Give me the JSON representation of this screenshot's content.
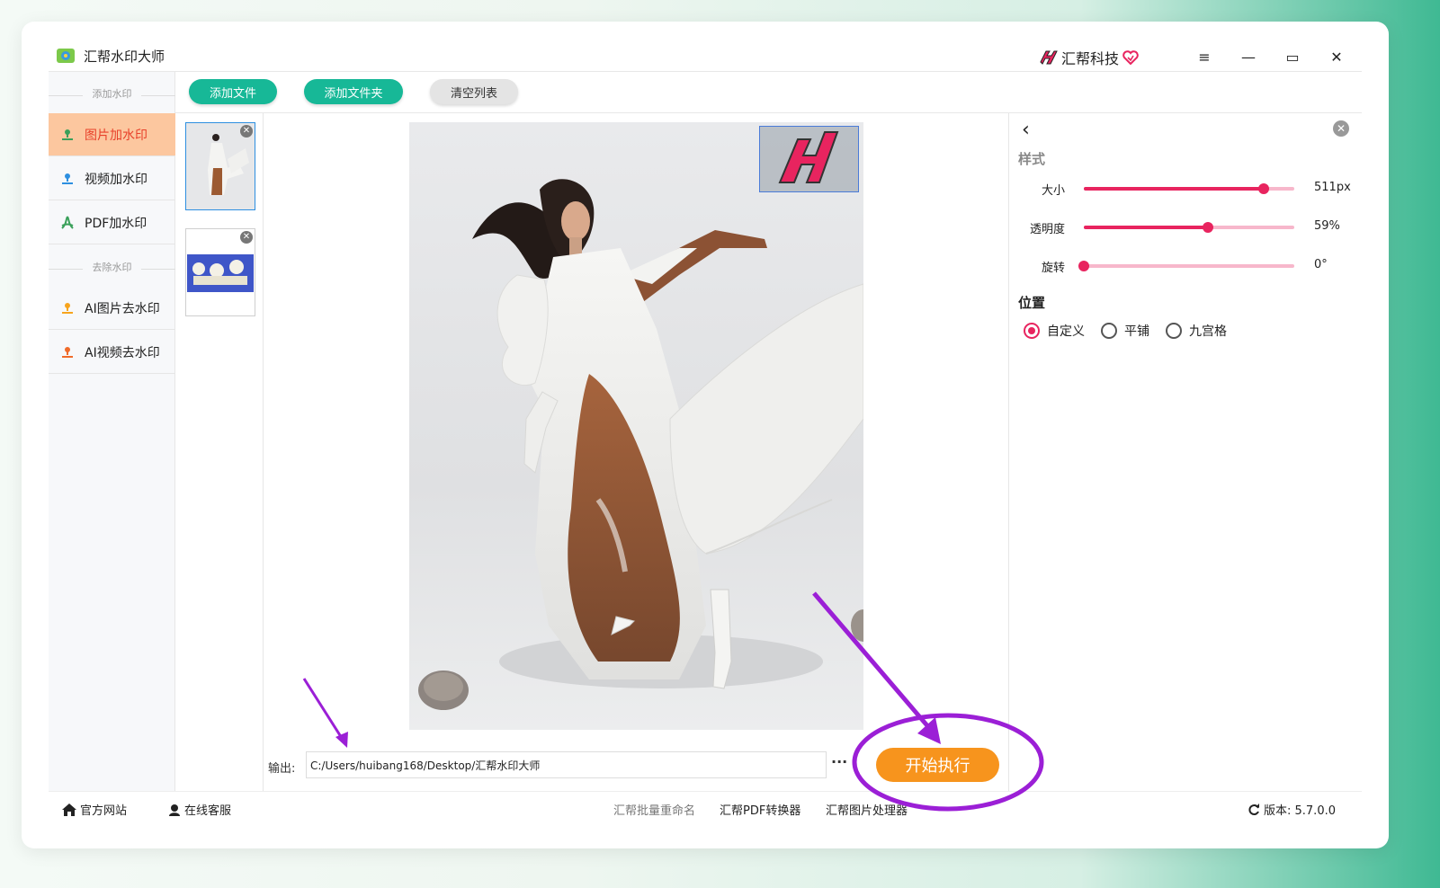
{
  "app": {
    "title": "汇帮水印大师",
    "brand": "汇帮科技"
  },
  "window_controls": {
    "menu": "≡",
    "minimize": "—",
    "maximize": "▭",
    "close": "✕"
  },
  "sidebar": {
    "section_add": "添加水印",
    "section_remove": "去除水印",
    "items": [
      {
        "label": "图片加水印",
        "icon": "image-watermark-icon",
        "active": true
      },
      {
        "label": "视频加水印",
        "icon": "video-watermark-icon"
      },
      {
        "label": "PDF加水印",
        "icon": "pdf-watermark-icon"
      },
      {
        "label": "AI图片去水印",
        "icon": "ai-image-remove-icon"
      },
      {
        "label": "AI视频去水印",
        "icon": "ai-video-remove-icon"
      }
    ]
  },
  "toolbar": {
    "add_file": "添加文件",
    "add_folder": "添加文件夹",
    "clear_list": "清空列表"
  },
  "thumbnails": [
    {
      "name": "photo-thumbnail",
      "selected": true
    },
    {
      "name": "comic-thumbnail",
      "selected": false
    }
  ],
  "output": {
    "label": "输出:",
    "path": "C:/Users/huibang168/Desktop/汇帮水印大师",
    "more": "···"
  },
  "start_button": "开始执行",
  "settings": {
    "style_heading": "样式",
    "size": {
      "label": "大小",
      "value": "511px",
      "fraction": 0.855
    },
    "opacity": {
      "label": "透明度",
      "value": "59%",
      "fraction": 0.59
    },
    "rotation": {
      "label": "旋转",
      "value": "0°",
      "fraction": 0.0
    },
    "position_heading": "位置",
    "position_options": [
      {
        "label": "自定义",
        "selected": true
      },
      {
        "label": "平铺",
        "selected": false
      },
      {
        "label": "九宫格",
        "selected": false
      }
    ]
  },
  "footer": {
    "website": "官方网站",
    "support": "在线客服",
    "links": [
      "汇帮批量重命名",
      "汇帮PDF转换器",
      "汇帮图片处理器"
    ],
    "version": "版本: 5.7.0.0"
  },
  "colors": {
    "accent_green": "#17b897",
    "accent_pink": "#e8245f",
    "start_orange": "#f7941d",
    "annotation_purple": "#9b1fd6",
    "active_item_bg": "#fcc79f"
  }
}
